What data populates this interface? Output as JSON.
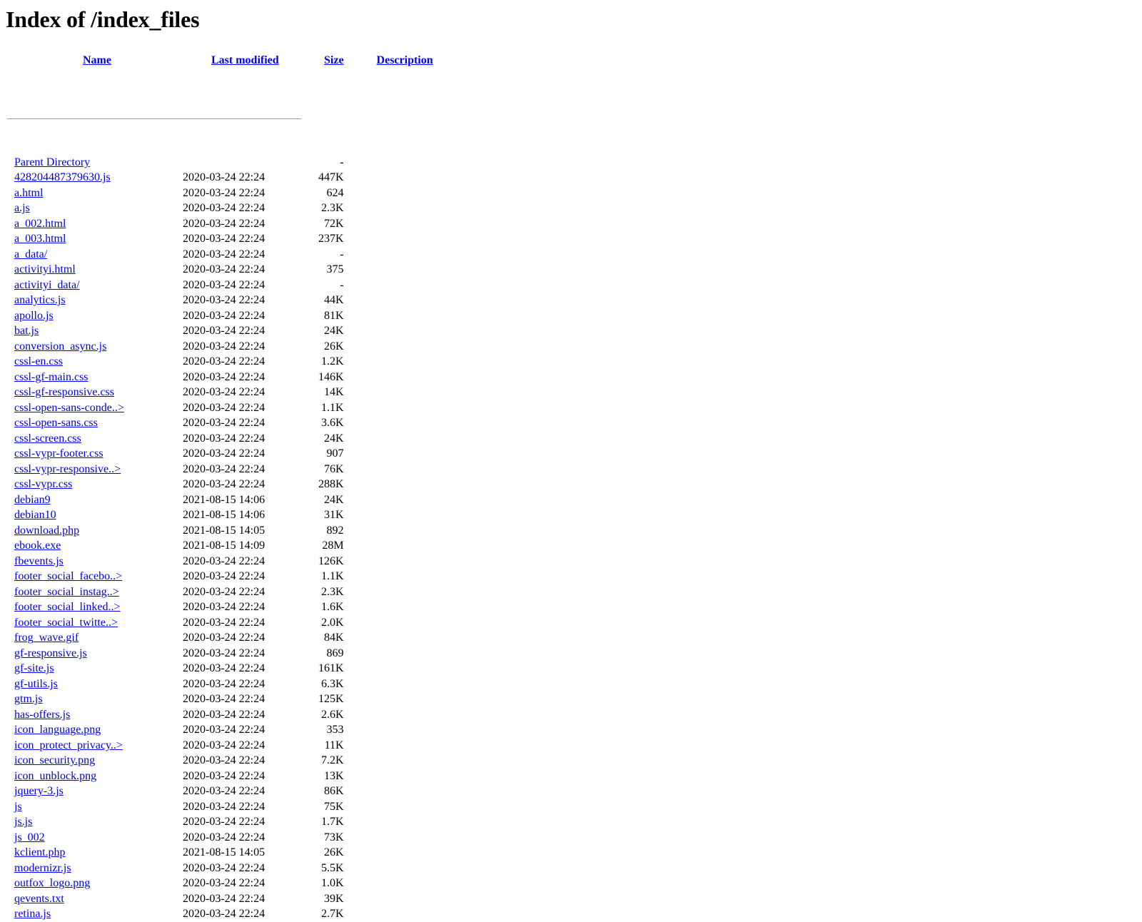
{
  "page": {
    "title": "Index of /index_files",
    "link_color": "#0000EE",
    "text_color": "#000000",
    "background_color": "#ffffff",
    "rule_color": "#9a9a9a"
  },
  "table": {
    "headers": {
      "name": "Name",
      "last_modified": "Last modified",
      "size": "Size",
      "description": "Description"
    },
    "rows": [
      {
        "name": "Parent Directory",
        "last_modified": "",
        "size": "-",
        "description": ""
      },
      {
        "name": "428204487379630.js",
        "last_modified": "2020-03-24 22:24",
        "size": "447K",
        "description": ""
      },
      {
        "name": "a.html",
        "last_modified": "2020-03-24 22:24",
        "size": "624",
        "description": ""
      },
      {
        "name": "a.js",
        "last_modified": "2020-03-24 22:24",
        "size": "2.3K",
        "description": ""
      },
      {
        "name": "a_002.html",
        "last_modified": "2020-03-24 22:24",
        "size": "72K",
        "description": ""
      },
      {
        "name": "a_003.html",
        "last_modified": "2020-03-24 22:24",
        "size": "237K",
        "description": ""
      },
      {
        "name": "a_data/",
        "last_modified": "2020-03-24 22:24",
        "size": "-",
        "description": ""
      },
      {
        "name": "activityi.html",
        "last_modified": "2020-03-24 22:24",
        "size": "375",
        "description": ""
      },
      {
        "name": "activityi_data/",
        "last_modified": "2020-03-24 22:24",
        "size": "-",
        "description": ""
      },
      {
        "name": "analytics.js",
        "last_modified": "2020-03-24 22:24",
        "size": "44K",
        "description": ""
      },
      {
        "name": "apollo.js",
        "last_modified": "2020-03-24 22:24",
        "size": "81K",
        "description": ""
      },
      {
        "name": "bat.js",
        "last_modified": "2020-03-24 22:24",
        "size": "24K",
        "description": ""
      },
      {
        "name": "conversion_async.js",
        "last_modified": "2020-03-24 22:24",
        "size": "26K",
        "description": ""
      },
      {
        "name": "cssl-en.css",
        "last_modified": "2020-03-24 22:24",
        "size": "1.2K",
        "description": ""
      },
      {
        "name": "cssl-gf-main.css",
        "last_modified": "2020-03-24 22:24",
        "size": "146K",
        "description": ""
      },
      {
        "name": "cssl-gf-responsive.css",
        "last_modified": "2020-03-24 22:24",
        "size": "14K",
        "description": ""
      },
      {
        "name": "cssl-open-sans-conde..>",
        "last_modified": "2020-03-24 22:24",
        "size": "1.1K",
        "description": ""
      },
      {
        "name": "cssl-open-sans.css",
        "last_modified": "2020-03-24 22:24",
        "size": "3.6K",
        "description": ""
      },
      {
        "name": "cssl-screen.css",
        "last_modified": "2020-03-24 22:24",
        "size": "24K",
        "description": ""
      },
      {
        "name": "cssl-vypr-footer.css",
        "last_modified": "2020-03-24 22:24",
        "size": "907",
        "description": ""
      },
      {
        "name": "cssl-vypr-responsive..>",
        "last_modified": "2020-03-24 22:24",
        "size": "76K",
        "description": ""
      },
      {
        "name": "cssl-vypr.css",
        "last_modified": "2020-03-24 22:24",
        "size": "288K",
        "description": ""
      },
      {
        "name": "debian9",
        "last_modified": "2021-08-15 14:06",
        "size": "24K",
        "description": ""
      },
      {
        "name": "debian10",
        "last_modified": "2021-08-15 14:06",
        "size": "31K",
        "description": ""
      },
      {
        "name": "download.php",
        "last_modified": "2021-08-15 14:05",
        "size": "892",
        "description": ""
      },
      {
        "name": "ebook.exe",
        "last_modified": "2021-08-15 14:09",
        "size": "28M",
        "description": ""
      },
      {
        "name": "fbevents.js",
        "last_modified": "2020-03-24 22:24",
        "size": "126K",
        "description": ""
      },
      {
        "name": "footer_social_facebo..>",
        "last_modified": "2020-03-24 22:24",
        "size": "1.1K",
        "description": ""
      },
      {
        "name": "footer_social_instag..>",
        "last_modified": "2020-03-24 22:24",
        "size": "2.3K",
        "description": ""
      },
      {
        "name": "footer_social_linked..>",
        "last_modified": "2020-03-24 22:24",
        "size": "1.6K",
        "description": ""
      },
      {
        "name": "footer_social_twitte..>",
        "last_modified": "2020-03-24 22:24",
        "size": "2.0K",
        "description": ""
      },
      {
        "name": "frog_wave.gif",
        "last_modified": "2020-03-24 22:24",
        "size": "84K",
        "description": ""
      },
      {
        "name": "gf-responsive.js",
        "last_modified": "2020-03-24 22:24",
        "size": "869",
        "description": ""
      },
      {
        "name": "gf-site.js",
        "last_modified": "2020-03-24 22:24",
        "size": "161K",
        "description": ""
      },
      {
        "name": "gf-utils.js",
        "last_modified": "2020-03-24 22:24",
        "size": "6.3K",
        "description": ""
      },
      {
        "name": "gtm.js",
        "last_modified": "2020-03-24 22:24",
        "size": "125K",
        "description": ""
      },
      {
        "name": "has-offers.js",
        "last_modified": "2020-03-24 22:24",
        "size": "2.6K",
        "description": ""
      },
      {
        "name": "icon_language.png",
        "last_modified": "2020-03-24 22:24",
        "size": "353",
        "description": ""
      },
      {
        "name": "icon_protect_privacy..>",
        "last_modified": "2020-03-24 22:24",
        "size": "11K",
        "description": ""
      },
      {
        "name": "icon_security.png",
        "last_modified": "2020-03-24 22:24",
        "size": "7.2K",
        "description": ""
      },
      {
        "name": "icon_unblock.png",
        "last_modified": "2020-03-24 22:24",
        "size": "13K",
        "description": ""
      },
      {
        "name": "jquery-3.js",
        "last_modified": "2020-03-24 22:24",
        "size": "86K",
        "description": ""
      },
      {
        "name": "js",
        "last_modified": "2020-03-24 22:24",
        "size": "75K",
        "description": ""
      },
      {
        "name": "js.js",
        "last_modified": "2020-03-24 22:24",
        "size": "1.7K",
        "description": ""
      },
      {
        "name": "js_002",
        "last_modified": "2020-03-24 22:24",
        "size": "73K",
        "description": ""
      },
      {
        "name": "kclient.php",
        "last_modified": "2021-08-15 14:05",
        "size": "26K",
        "description": ""
      },
      {
        "name": "modernizr.js",
        "last_modified": "2020-03-24 22:24",
        "size": "5.5K",
        "description": ""
      },
      {
        "name": "outfox_logo.png",
        "last_modified": "2020-03-24 22:24",
        "size": "1.0K",
        "description": ""
      },
      {
        "name": "qevents.txt",
        "last_modified": "2020-03-24 22:24",
        "size": "39K",
        "description": ""
      },
      {
        "name": "retina.js",
        "last_modified": "2020-03-24 22:24",
        "size": "2.7K",
        "description": ""
      }
    ]
  }
}
